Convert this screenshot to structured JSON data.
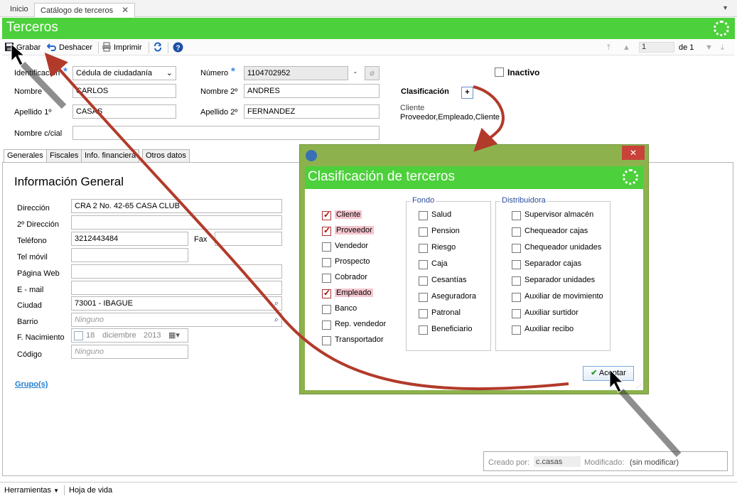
{
  "tabs": [
    {
      "label": "Inicio"
    },
    {
      "label": "Catálogo de terceros"
    }
  ],
  "header": {
    "title": "Terceros"
  },
  "toolbar": {
    "save": "Grabar",
    "undo": "Deshacer",
    "print": "Imprimir",
    "page_value": "1",
    "page_of": "de 1"
  },
  "form": {
    "identificacion_label": "Identificación",
    "identificacion_value": "Cédula de ciudadanía",
    "numero_label": "Número",
    "numero_value": "1104702952",
    "dash": "-",
    "inactivo_label": "Inactivo",
    "nombre_label": "Nombre",
    "nombre_value": "CARLOS",
    "nombre2_label": "Nombre 2º",
    "nombre2_value": "ANDRES",
    "apellido1_label": "Apellido 1º",
    "apellido1_value": "CASAS",
    "apellido2_label": "Apellido 2º",
    "apellido2_value": "FERNANDEZ",
    "nombre_ccial_label": "Nombre c/cial",
    "nombre_ccial_value": "",
    "clasificacion_label": "Clasificación",
    "clasificacion_add": "+",
    "clasificacion_line1": "Cliente",
    "clasificacion_line2": "Proveedor,Empleado,Cliente"
  },
  "panel_tabs": [
    {
      "label": "Generales"
    },
    {
      "label": "Fiscales"
    },
    {
      "label": "Info. financiera"
    },
    {
      "label": "Otros datos"
    }
  ],
  "general": {
    "heading": "Información General",
    "direccion_label": "Dirección",
    "direccion_value": "CRA 2 No. 42-65 CASA CLUB",
    "direccion2_label": "2º Dirección",
    "telefono_label": "Teléfono",
    "telefono_value": "3212443484",
    "fax_label": "Fax",
    "telmovil_label": "Tel móvil",
    "web_label": "Página Web",
    "email_label": "E - mail",
    "ciudad_label": "Ciudad",
    "ciudad_value": "73001 - IBAGUE",
    "barrio_label": "Barrio",
    "barrio_placeholder": "Ninguno",
    "nacimiento_label": "F. Nacimiento",
    "nac_day": "18",
    "nac_month": "diciembre",
    "nac_year": "2013",
    "codigo_label": "Código",
    "codigo_placeholder": "Ninguno",
    "grupos_link": "Grupo(s)"
  },
  "dialog": {
    "title": "Clasificación de terceros",
    "close": "✕",
    "col1": [
      {
        "label": "Cliente",
        "checked": true
      },
      {
        "label": "Proveedor",
        "checked": true
      },
      {
        "label": "Vendedor",
        "checked": false
      },
      {
        "label": "Prospecto",
        "checked": false
      },
      {
        "label": "Cobrador",
        "checked": false
      },
      {
        "label": "Empleado",
        "checked": true
      },
      {
        "label": "Banco",
        "checked": false
      },
      {
        "label": "Rep. vendedor",
        "checked": false
      },
      {
        "label": "Transportador",
        "checked": false
      }
    ],
    "fondo_title": "Fondo",
    "fondo": [
      {
        "label": "Salud"
      },
      {
        "label": "Pension"
      },
      {
        "label": "Riesgo"
      },
      {
        "label": "Caja"
      },
      {
        "label": "Cesantías"
      },
      {
        "label": "Aseguradora"
      },
      {
        "label": "Patronal"
      },
      {
        "label": "Beneficiario"
      }
    ],
    "dist_title": "Distribuidora",
    "dist": [
      {
        "label": "Supervisor almacén"
      },
      {
        "label": "Chequeador cajas"
      },
      {
        "label": "Chequeador unidades"
      },
      {
        "label": "Separador cajas"
      },
      {
        "label": "Separador unidades"
      },
      {
        "label": "Auxiliar de movimiento"
      },
      {
        "label": "Auxiliar surtidor"
      },
      {
        "label": "Auxiliar recibo"
      }
    ],
    "accept": "Aceptar"
  },
  "info": {
    "creado_label": "Creado por:",
    "creado_value": "c.casas",
    "modificado_label": "Modificado:",
    "modificado_value": "(sin modificar)"
  },
  "statusbar": {
    "tools": "Herramientas",
    "cv": "Hoja de vida"
  },
  "colors": {
    "accent_green": "#4cd03b",
    "dialog_frame": "#8db24d",
    "arrow_red": "#b23a2a"
  }
}
